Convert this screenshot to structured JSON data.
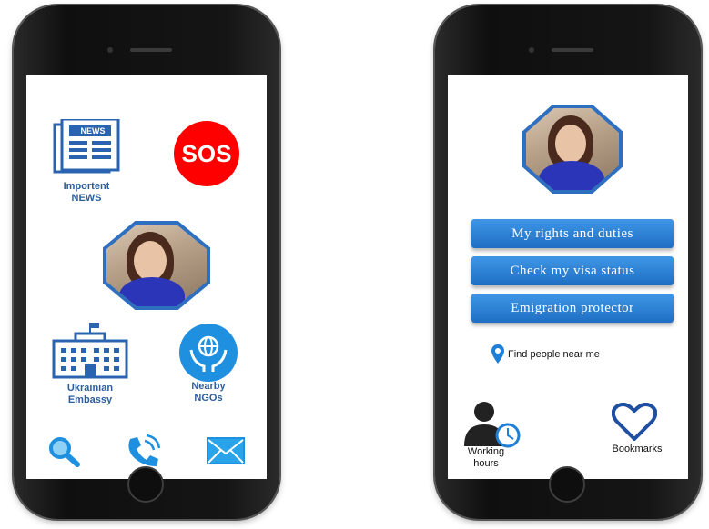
{
  "left_screen": {
    "news_icon_text": "NEWS",
    "news_label_1": "Importent",
    "news_label_2": "NEWS",
    "sos_label": "SOS",
    "embassy_label_1": "Ukrainian",
    "embassy_label_2": "Embassy",
    "ngo_label_1": "Nearby",
    "ngo_label_2": "NGOs"
  },
  "right_screen": {
    "buttons": [
      "My rights and duties",
      "Check my visa status",
      "Emigration protector"
    ],
    "find_people": "Find people near me",
    "working_hours_1": "Working",
    "working_hours_2": "hours",
    "bookmarks": "Bookmarks"
  },
  "colors": {
    "accent": "#2e7bd1",
    "sos": "#ff0000",
    "icon_blue": "#1f8fe0"
  }
}
